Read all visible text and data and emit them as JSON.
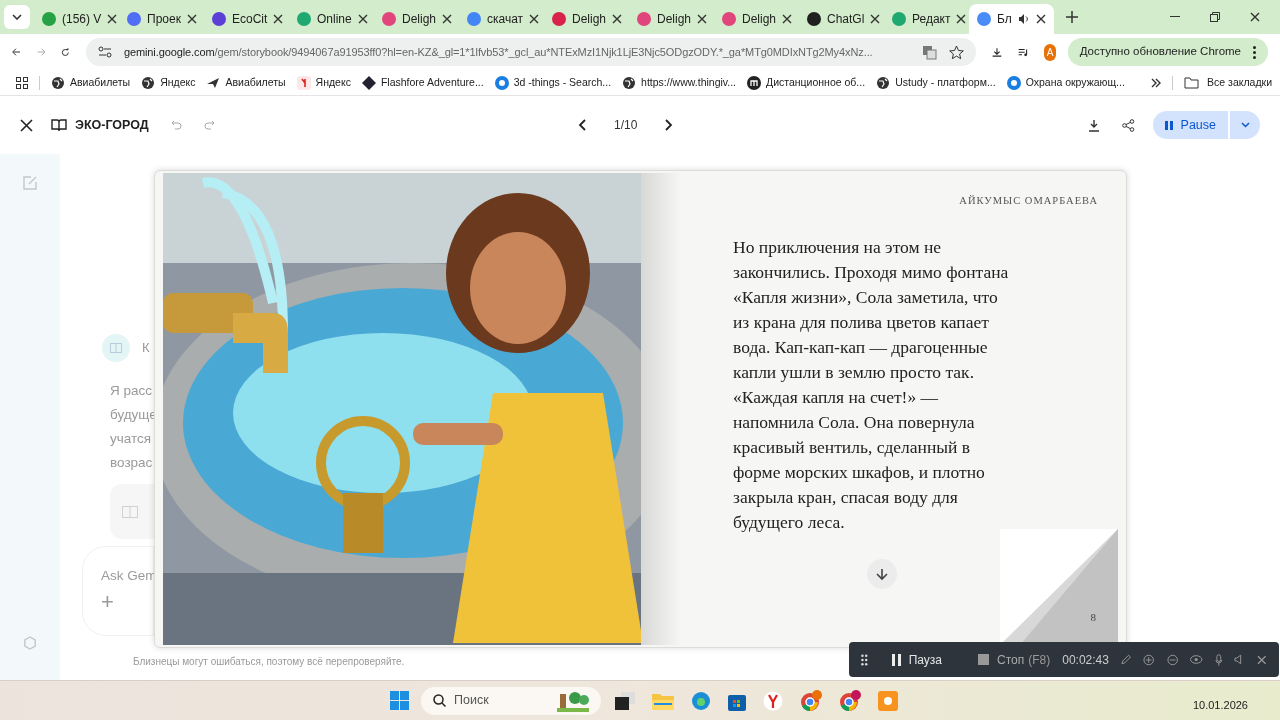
{
  "browser": {
    "tabs": [
      {
        "label": "(156) V",
        "selected": false,
        "color": "#25a244"
      },
      {
        "label": "Проек",
        "selected": false,
        "color": "#4f6df5"
      },
      {
        "label": "EcoCit",
        "selected": false,
        "color": "#5b3fd6"
      },
      {
        "label": "Online",
        "selected": false,
        "color": "#1fa870"
      },
      {
        "label": "Deligh",
        "selected": false,
        "color": "#e0457b"
      },
      {
        "label": "скачат",
        "selected": false,
        "color": "#4285f4"
      },
      {
        "label": "Deligh",
        "selected": false,
        "color": "#d9224a"
      },
      {
        "label": "Deligh",
        "selected": false,
        "color": "#e0457b"
      },
      {
        "label": "Deligh",
        "selected": false,
        "color": "#e0457b"
      },
      {
        "label": "ChatGl",
        "selected": false,
        "color": "#202020"
      },
      {
        "label": "Редакт",
        "selected": false,
        "color": "#1fa870"
      },
      {
        "label": "Бл",
        "selected": true,
        "color": "#4a8cf7"
      }
    ],
    "url_host": "gemini.google.com",
    "url_path": "/gem/storybook/9494067a91953ff0?hl=en-KZ&_gl=1*1lfvb53*_gcl_au*NTExMzI1Njk1LjE3Njc5ODgzODY.*_ga*MTg0MDIxNTg2My4xNz...",
    "profile": "A",
    "update_button": "Доступно обновление Chrome"
  },
  "bookmarks": [
    "Авиабилеты",
    "Яндекс",
    "Авиабилеты",
    "Яндекс",
    "Flashfore Adventure...",
    "3d -things - Search...",
    "https://www.thingiv...",
    "Дистанционное об...",
    "Ustudy - платформ...",
    "Охрана окружающ..."
  ],
  "all_bookmarks": "Все закладки",
  "app": {
    "title": "ЭКО-ГОРОД",
    "page": "1/10",
    "pause": "Pause"
  },
  "background_chat": {
    "heading": "К",
    "lines": [
      "Я расс",
      "будуще",
      "учатся",
      "возрас"
    ],
    "input_placeholder": "Ask Gem",
    "add": "+",
    "disclaimer": "Близнецы могут ошибаться, поэтому всё перепроверяйте."
  },
  "book": {
    "author": "АЙКУМЫС ОМАРБАЕВА",
    "text": "Но приключения на этом не закончились. Проходя мимо фонтана «Капля жизни», Сола заметила, что из крана для полива цветов капает вода. Кап-кап-кап — драгоценные капли ушли в землю просто так. «Каждая капля на счет!» — напомнила Сола. Она повернула красивый вентиль, сделанный в форме морских шкафов, и плотно закрыла кран, спасая воду для будущего леса.",
    "page_number": "8"
  },
  "recorder": {
    "pause": "Пауза",
    "stop": "Стоп",
    "shortcut": "(F8)",
    "time": "00:02:43"
  },
  "taskbar": {
    "search": "Поиск",
    "date": "10.01.2026"
  }
}
